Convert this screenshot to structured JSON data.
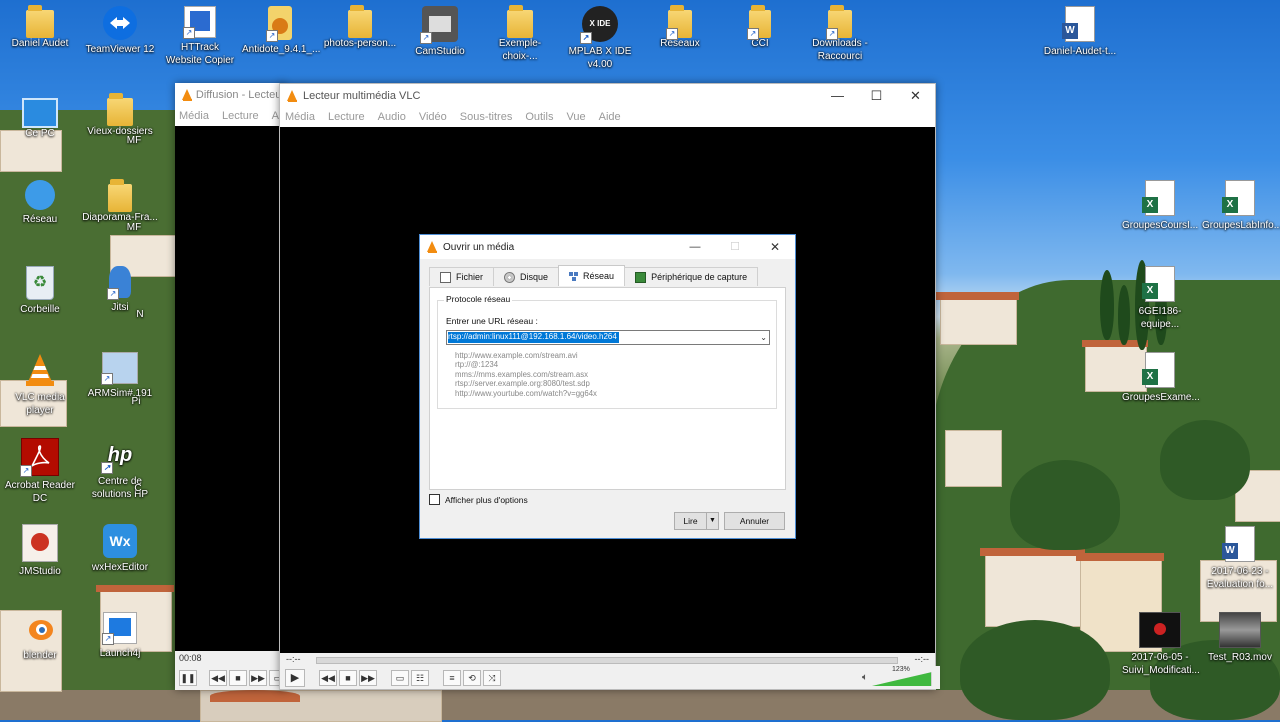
{
  "colors": {
    "vlc_orange": "#f28c10",
    "selection_blue": "#0078d7",
    "dialog_border": "#4f8fd6",
    "volume_green": "#3fb93f"
  },
  "desktop": {
    "icons": [
      {
        "label": "Daniel Audet",
        "icon": "user-folder-icon"
      },
      {
        "label": "TeamViewer 12",
        "icon": "teamviewer-icon"
      },
      {
        "label": "HTTrack Website Copier",
        "icon": "httrack-icon"
      },
      {
        "label": "Antidote_9.4.1_...",
        "icon": "antidote-icon"
      },
      {
        "label": "photos-person...",
        "icon": "folder-icon"
      },
      {
        "label": "CamStudio",
        "icon": "camstudio-icon"
      },
      {
        "label": "Exemple-choix-...",
        "icon": "folder-icon"
      },
      {
        "label": "MPLAB X IDE v4.00",
        "icon": "mplab-icon"
      },
      {
        "label": "Reseaux",
        "icon": "folder-icon"
      },
      {
        "label": "CCI",
        "icon": "folder-icon"
      },
      {
        "label": "Downloads - Raccourci",
        "icon": "folder-icon"
      },
      {
        "label": "Daniel-Audet-t...",
        "icon": "word-doc-icon"
      },
      {
        "label": "Ce PC",
        "icon": "computer-icon"
      },
      {
        "label": "Vieux-dossiers",
        "icon": "folder-icon"
      },
      {
        "label": "Réseau",
        "icon": "network-icon"
      },
      {
        "label": "Diaporama-Fra...",
        "icon": "folder-icon"
      },
      {
        "label": "Corbeille",
        "icon": "recycle-bin-icon"
      },
      {
        "label": "Jitsi",
        "icon": "jitsi-icon"
      },
      {
        "label": "VLC media player",
        "icon": "vlc-icon"
      },
      {
        "label": "ARMSim#.191",
        "icon": "armsim-icon"
      },
      {
        "label": "Acrobat Reader DC",
        "icon": "acrobat-icon"
      },
      {
        "label": "Centre de solutions HP",
        "icon": "hp-icon"
      },
      {
        "label": "JMStudio",
        "icon": "jmstudio-icon"
      },
      {
        "label": "wxHexEditor",
        "icon": "wxhexeditor-icon"
      },
      {
        "label": "blender",
        "icon": "blender-icon"
      },
      {
        "label": "Launch4j",
        "icon": "launch4j-icon"
      },
      {
        "label": "GroupesCoursI...",
        "icon": "excel-icon"
      },
      {
        "label": "GroupesLabInfo...",
        "icon": "excel-icon"
      },
      {
        "label": "6GEI186-equipe...",
        "icon": "excel-icon"
      },
      {
        "label": "GroupesExame...",
        "icon": "excel-icon"
      },
      {
        "label": "2017-06-23 - Evaluation fo...",
        "icon": "word-doc-icon"
      },
      {
        "label": "2017-06-05 - Suivi_Modificati...",
        "icon": "video-thumb-icon"
      },
      {
        "label": "Test_R03.mov",
        "icon": "video-thumb-icon"
      }
    ],
    "partial_labels": {
      "mf1": "MF",
      "mf2": "MF",
      "n": "N",
      "pi": "Pi",
      "c": "C"
    }
  },
  "diffusion_window": {
    "title": "Diffusion - Lecteur",
    "menu": [
      "Média",
      "Lecture",
      "Aud"
    ],
    "time": "00:08"
  },
  "vlc_window": {
    "title": "Lecteur multimédia VLC",
    "menu": [
      "Média",
      "Lecture",
      "Audio",
      "Vidéo",
      "Sous-titres",
      "Outils",
      "Vue",
      "Aide"
    ],
    "time_left": "--:--",
    "time_right": "--:--",
    "volume": "123%",
    "volume_level": 1.23
  },
  "dialog": {
    "title": "Ouvrir un média",
    "tabs": [
      "Fichier",
      "Disque",
      "Réseau",
      "Périphérique de capture"
    ],
    "active_tab": "Réseau",
    "group_title": "Protocole réseau",
    "url_label": "Entrer une URL réseau :",
    "url_value": "rtsp://admin:linux111@192.168.1.64/video.h264",
    "examples": [
      "http://www.example.com/stream.avi",
      "rtp://@:1234",
      "mms://mms.examples.com/stream.asx",
      "rtsp://server.example.org:8080/test.sdp",
      "http://www.yourtube.com/watch?v=gg64x"
    ],
    "show_more_options": "Afficher plus d'options",
    "play_button": "Lire",
    "cancel_button": "Annuler"
  }
}
